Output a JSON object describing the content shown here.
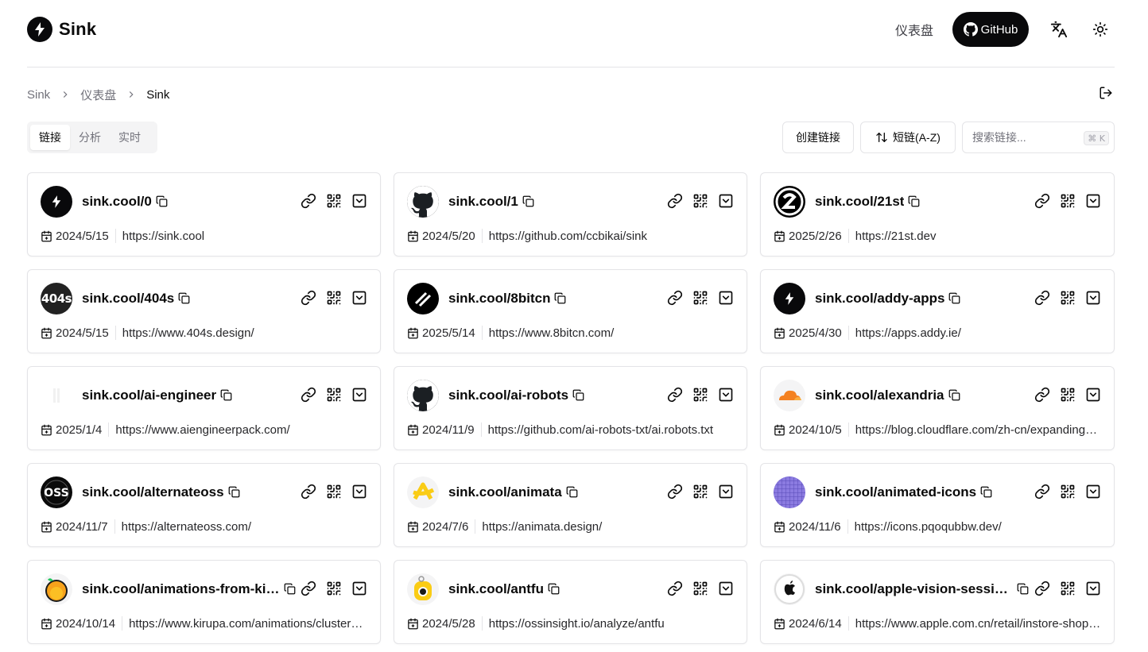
{
  "header": {
    "brand": "Sink",
    "nav_dashboard": "仪表盘",
    "github_label": "GitHub"
  },
  "breadcrumb": [
    "Sink",
    "仪表盘",
    "Sink"
  ],
  "tabs": [
    {
      "label": "链接",
      "active": true
    },
    {
      "label": "分析",
      "active": false
    },
    {
      "label": "实时",
      "active": false
    }
  ],
  "toolbar": {
    "create_label": "创建链接",
    "sort_label": "短链(A-Z)",
    "search_placeholder": "搜索链接...",
    "search_shortcut": "⌘ K"
  },
  "links": [
    {
      "slug": "sink.cool/0",
      "date": "2024/5/15",
      "url": "https://sink.cool",
      "avatar": "bolt",
      "avatar_bg": "#09090b"
    },
    {
      "slug": "sink.cool/1",
      "date": "2024/5/20",
      "url": "https://github.com/ccbikai/sink",
      "avatar": "github",
      "avatar_bg": "#1b1f23"
    },
    {
      "slug": "sink.cool/21st",
      "date": "2025/2/26",
      "url": "https://21st.dev",
      "avatar": "21st",
      "avatar_bg": "#000000"
    },
    {
      "slug": "sink.cool/404s",
      "date": "2024/5/15",
      "url": "https://www.404s.design/",
      "avatar": "404s",
      "avatar_bg": "#222222"
    },
    {
      "slug": "sink.cool/8bitcn",
      "date": "2025/5/14",
      "url": "https://www.8bitcn.com/",
      "avatar": "8bit",
      "avatar_bg": "#000000"
    },
    {
      "slug": "sink.cool/addy-apps",
      "date": "2025/4/30",
      "url": "https://apps.addy.ie/",
      "avatar": "bolt",
      "avatar_bg": "#09090b"
    },
    {
      "slug": "sink.cool/ai-engineer",
      "date": "2025/1/4",
      "url": "https://www.aiengineerpack.com/",
      "avatar": "blank",
      "avatar_bg": "#ffffff"
    },
    {
      "slug": "sink.cool/ai-robots",
      "date": "2024/11/9",
      "url": "https://github.com/ai-robots-txt/ai.robots.txt",
      "avatar": "github",
      "avatar_bg": "#1b1f23"
    },
    {
      "slug": "sink.cool/alexandria",
      "date": "2024/10/5",
      "url": "https://blog.cloudflare.com/zh-cn/expanding-our-support-for-ai-crawlers/",
      "avatar": "cloud",
      "avatar_bg": "#f4f4f5"
    },
    {
      "slug": "sink.cool/alternateoss",
      "date": "2024/11/7",
      "url": "https://alternateoss.com/",
      "avatar": "oss",
      "avatar_bg": "#0a0a0a"
    },
    {
      "slug": "sink.cool/animata",
      "date": "2024/7/6",
      "url": "https://animata.design/",
      "avatar": "animata",
      "avatar_bg": "#f4f4f5"
    },
    {
      "slug": "sink.cool/animated-icons",
      "date": "2024/11/6",
      "url": "https://icons.pqoqubbw.dev/",
      "avatar": "purple",
      "avatar_bg": "#7c6bd6"
    },
    {
      "slug": "sink.cool/animations-from-kirupa",
      "date": "2024/10/14",
      "url": "https://www.kirupa.com/animations/clusters/animations.htm",
      "avatar": "orange",
      "avatar_bg": "#f4f4f5"
    },
    {
      "slug": "sink.cool/antfu",
      "date": "2024/5/28",
      "url": "https://ossinsight.io/analyze/antfu",
      "avatar": "ossinsight",
      "avatar_bg": "#f4f4f5"
    },
    {
      "slug": "sink.cool/apple-vision-sessions",
      "date": "2024/6/14",
      "url": "https://www.apple.com.cn/retail/instore-shopping-session/",
      "avatar": "apple",
      "avatar_bg": "#f4f4f5"
    }
  ]
}
